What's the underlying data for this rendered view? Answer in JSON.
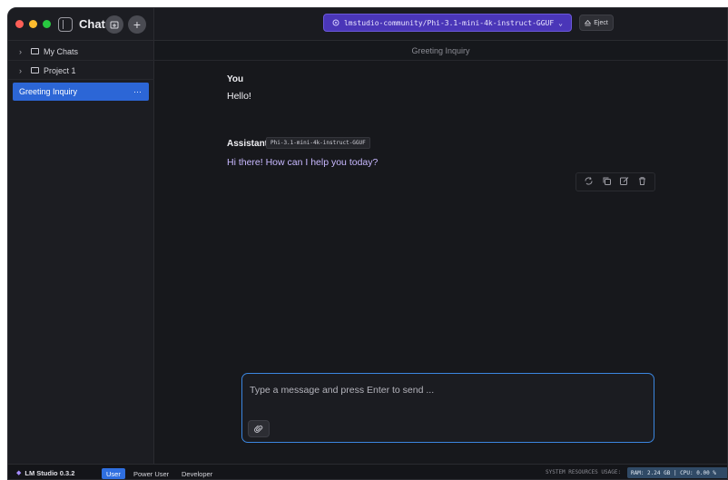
{
  "sidebar": {
    "title": "Chats",
    "new_folder_label": "+",
    "new_chat_label": "+",
    "folders": [
      {
        "label": "My Chats",
        "chevron": "›"
      },
      {
        "label": "Project 1",
        "chevron": "›"
      }
    ],
    "active_chat": {
      "label": "Greeting Inquiry",
      "menu": "···"
    }
  },
  "topbar": {
    "model": "lmstudio-community/Phi-3.1-mini-4k-instruct-GGUF",
    "model_chevron": "⌄",
    "eject_label": "Eject"
  },
  "conversation": {
    "title": "Greeting Inquiry",
    "messages": [
      {
        "role": "You",
        "text": "Hello!"
      },
      {
        "role": "Assistant",
        "model_tag": "Phi-3.1-mini-4k-instruct-GGUF",
        "text": "Hi there! How can I help you today?"
      }
    ]
  },
  "composer": {
    "placeholder": "Type a message and press Enter to send ..."
  },
  "statusbar": {
    "app_name": "LM Studio 0.3.2",
    "modes": [
      "User",
      "Power User",
      "Developer"
    ],
    "active_mode": "User",
    "system_label": "SYSTEM RESOURCES USAGE:",
    "usage": "RAM: 2.24 GB  |  CPU: 0.00 %"
  },
  "colors": {
    "accent": "#2c66d6",
    "model_pill": "#4a36b8",
    "assistant_text": "#c8b8ff",
    "composer_border": "#3b86e0"
  }
}
